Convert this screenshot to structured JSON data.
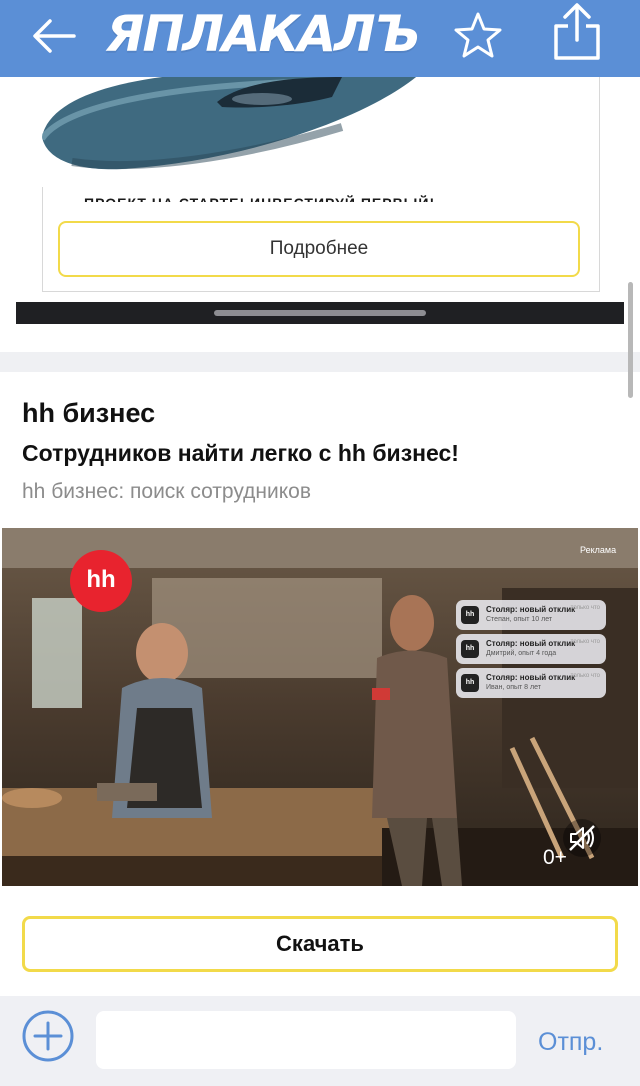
{
  "header": {
    "logo_text": "ЯПЛАКАЛЪ",
    "back_icon": "arrow-left-icon",
    "favorite_icon": "star-outline-icon",
    "share_icon": "share-icon",
    "bg_color": "#5b8fd6"
  },
  "prev_ad": {
    "clipped_text": "ПРОЕКТ НА СТАРТЕ! ИНВЕСТИРУЙ ПЕРВЫЙ!",
    "more_label": "Подробнее",
    "button_border_color": "#f2da4a"
  },
  "hh_ad": {
    "advertiser": "hh бизнес",
    "headline": "Сотрудников найти легко с hh бизнес!",
    "description": "hh бизнес: поиск сотрудников",
    "video": {
      "logo_text": "hh",
      "ad_label": "Реклама",
      "notifications": [
        {
          "title": "Столяр: новый отклик",
          "subtitle": "Степан, опыт 10 лет",
          "time": "только что"
        },
        {
          "title": "Столяр: новый отклик",
          "subtitle": "Дмитрий, опыт 4 года",
          "time": "только что"
        },
        {
          "title": "Столяр: новый отклик",
          "subtitle": "Иван, опыт 8 лет",
          "time": "только что"
        }
      ],
      "age_rating": "0+",
      "mute_icon": "speaker-muted-icon"
    },
    "download_label": "Скачать",
    "accent_color": "#e8232e"
  },
  "composer": {
    "add_icon": "plus-circle-icon",
    "input_value": "",
    "send_label": "Отпр."
  }
}
